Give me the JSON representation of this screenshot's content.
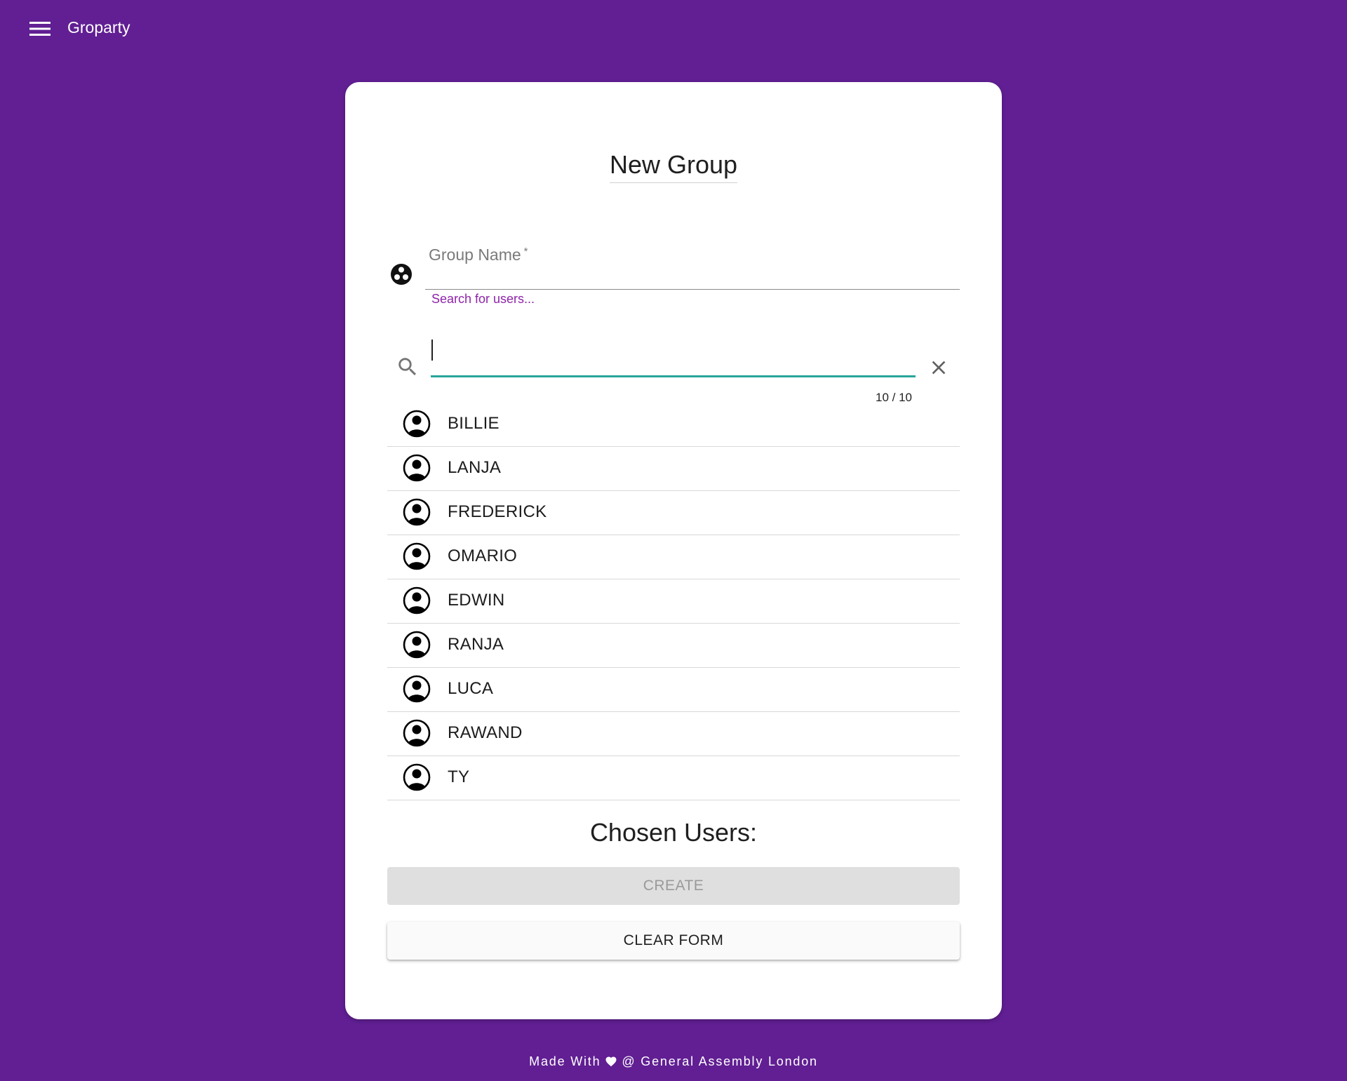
{
  "app": {
    "title": "Groparty"
  },
  "card": {
    "title": "New Group"
  },
  "group_name": {
    "label": "Group Name",
    "required_mark": "*",
    "value": "",
    "helper_text": "Search for users..."
  },
  "search": {
    "value": "",
    "counter": "10 / 10"
  },
  "users": [
    {
      "name": "BILLIE"
    },
    {
      "name": "LANJA"
    },
    {
      "name": "FREDERICK"
    },
    {
      "name": "OMARIO"
    },
    {
      "name": "EDWIN"
    },
    {
      "name": "RANJA"
    },
    {
      "name": "LUCA"
    },
    {
      "name": "RAWAND"
    },
    {
      "name": "TY"
    }
  ],
  "chosen": {
    "title": "Chosen Users:",
    "users": []
  },
  "actions": {
    "create_label": "CREATE",
    "clear_label": "CLEAR FORM"
  },
  "footer": {
    "prefix": "Made With",
    "suffix": "@ General Assembly London"
  },
  "colors": {
    "background": "#611f93",
    "accent": "#26a69a",
    "helper": "#8e24aa"
  },
  "icons": {
    "menu": "menu-icon",
    "group": "group-icon",
    "search": "search-icon",
    "clear": "close-icon",
    "avatar": "account-circle-icon",
    "heart": "heart-icon"
  }
}
